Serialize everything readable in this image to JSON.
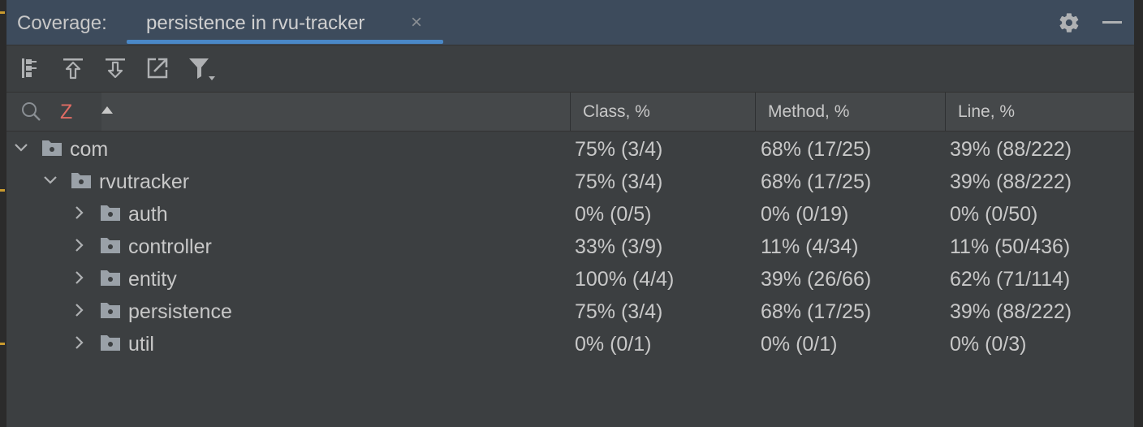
{
  "header": {
    "title": "Coverage:",
    "tab_label": "persistence in rvu-tracker",
    "tab_close": "×"
  },
  "toolbar": {
    "buttons": [
      "flatten-packages-icon",
      "navigate-up-icon",
      "navigate-down-icon",
      "export-icon",
      "filter-icon"
    ]
  },
  "columns": {
    "search_letter": "Z",
    "class": "Class, %",
    "method": "Method, %",
    "line": "Line, %"
  },
  "rows": [
    {
      "name": "com",
      "level": 0,
      "expanded": true,
      "class": "75% (3/4)",
      "method": "68% (17/25)",
      "line": "39% (88/222)"
    },
    {
      "name": "rvutracker",
      "level": 1,
      "expanded": true,
      "class": "75% (3/4)",
      "method": "68% (17/25)",
      "line": "39% (88/222)"
    },
    {
      "name": "auth",
      "level": 2,
      "expanded": false,
      "class": "0% (0/5)",
      "method": "0% (0/19)",
      "line": "0% (0/50)"
    },
    {
      "name": "controller",
      "level": 2,
      "expanded": false,
      "class": "33% (3/9)",
      "method": "11% (4/34)",
      "line": "11% (50/436)"
    },
    {
      "name": "entity",
      "level": 2,
      "expanded": false,
      "class": "100% (4/4)",
      "method": "39% (26/66)",
      "line": "62% (71/114)"
    },
    {
      "name": "persistence",
      "level": 2,
      "expanded": false,
      "class": "75% (3/4)",
      "method": "68% (17/25)",
      "line": "39% (88/222)"
    },
    {
      "name": "util",
      "level": 2,
      "expanded": false,
      "class": "0% (0/1)",
      "method": "0% (0/1)",
      "line": "0% (0/3)"
    }
  ],
  "colors": {
    "header_bg": "#3d4b5c",
    "tab_underline": "#4a88c7",
    "panel_bg": "#3c3f41",
    "text": "#c8c8c8",
    "search_letter": "#e06c64"
  }
}
